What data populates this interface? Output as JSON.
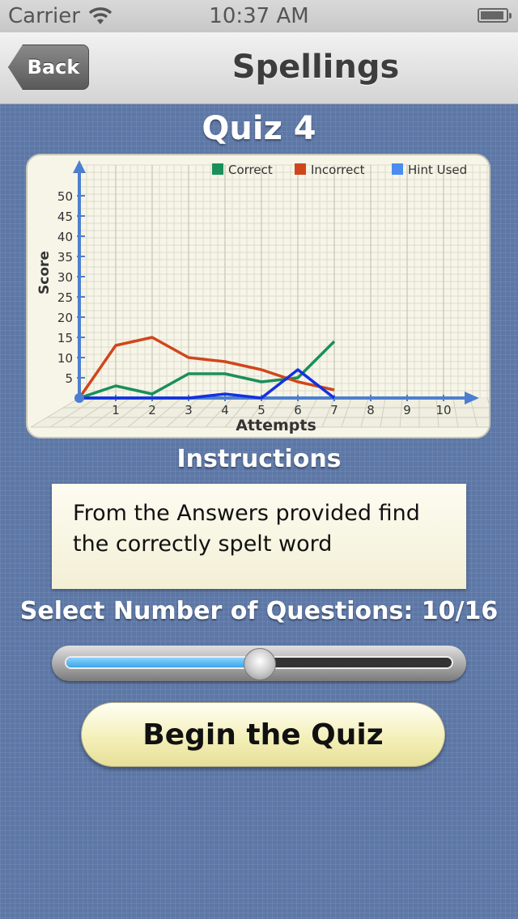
{
  "status_bar": {
    "carrier": "Carrier",
    "time": "10:37 AM"
  },
  "nav": {
    "back_label": "Back",
    "title": "Spellings"
  },
  "quiz_title": "Quiz 4",
  "chart_data": {
    "type": "line",
    "xlabel": "Attempts",
    "ylabel": "Score",
    "x_ticks": [
      1,
      2,
      3,
      4,
      5,
      6,
      7,
      8,
      9,
      10
    ],
    "y_ticks": [
      5,
      10,
      15,
      20,
      25,
      30,
      35,
      40,
      45,
      50
    ],
    "xlim": [
      0,
      10.5
    ],
    "ylim": [
      0,
      55
    ],
    "grid": true,
    "legend_position": "top-right",
    "series": [
      {
        "name": "Correct",
        "color": "#1a8f5a",
        "x": [
          0,
          1,
          2,
          3,
          4,
          5,
          6,
          7
        ],
        "y": [
          0,
          3,
          1,
          6,
          6,
          4,
          5,
          14
        ]
      },
      {
        "name": "Incorrect",
        "color": "#d0461c",
        "x": [
          0,
          1,
          2,
          3,
          4,
          5,
          6,
          7
        ],
        "y": [
          0,
          13,
          15,
          10,
          9,
          7,
          4,
          2
        ]
      },
      {
        "name": "Hint Used",
        "color": "#1430e0",
        "x": [
          0,
          1,
          2,
          3,
          4,
          5,
          6,
          7
        ],
        "y": [
          0,
          0,
          0,
          0,
          1,
          0,
          7,
          0
        ]
      }
    ]
  },
  "legend_swatch_colors": {
    "Correct": "#1a8f5a",
    "Incorrect": "#d0461c",
    "Hint Used": "#4a8cf0"
  },
  "instructions": {
    "title": "Instructions",
    "text": "From the Answers provided find the correctly spelt word"
  },
  "questions": {
    "label": "Select Number of Questions: 10/16",
    "value": 10,
    "max": 16,
    "fraction": 0.5
  },
  "begin_button": "Begin the Quiz"
}
